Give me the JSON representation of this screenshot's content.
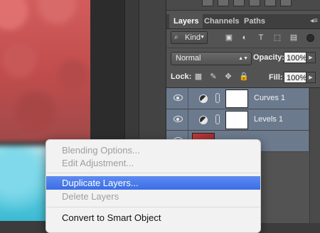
{
  "panel": {
    "tabs": [
      {
        "label": "Layers",
        "active": true
      },
      {
        "label": "Channels",
        "active": false
      },
      {
        "label": "Paths",
        "active": false
      }
    ],
    "filter": {
      "kind_label": "Kind",
      "icons": [
        "image-filter-icon",
        "adjustment-filter-icon",
        "type-filter-icon",
        "shape-filter-icon",
        "smart-object-filter-icon"
      ]
    },
    "blend_mode": "Normal",
    "opacity_label": "Opacity:",
    "opacity_value": "100%",
    "lock_label": "Lock:",
    "fill_label": "Fill:",
    "fill_value": "100%"
  },
  "layers": [
    {
      "name": "Curves 1",
      "type": "adjustment",
      "visible": true
    },
    {
      "name": "Levels 1",
      "type": "adjustment",
      "visible": true
    },
    {
      "name": "",
      "type": "image",
      "visible": true
    }
  ],
  "context_menu": {
    "items": [
      {
        "label": "Blending Options...",
        "enabled": false
      },
      {
        "label": "Edit Adjustment...",
        "enabled": false
      },
      {
        "label": "Duplicate Layers...",
        "enabled": true,
        "highlighted": true
      },
      {
        "label": "Delete Layers",
        "enabled": false
      },
      {
        "label": "Convert to Smart Object",
        "enabled": true
      }
    ]
  },
  "colors": {
    "panel_bg": "#535353",
    "selected_layer": "#6c7a8e",
    "menu_highlight": "#3b6ee6"
  }
}
